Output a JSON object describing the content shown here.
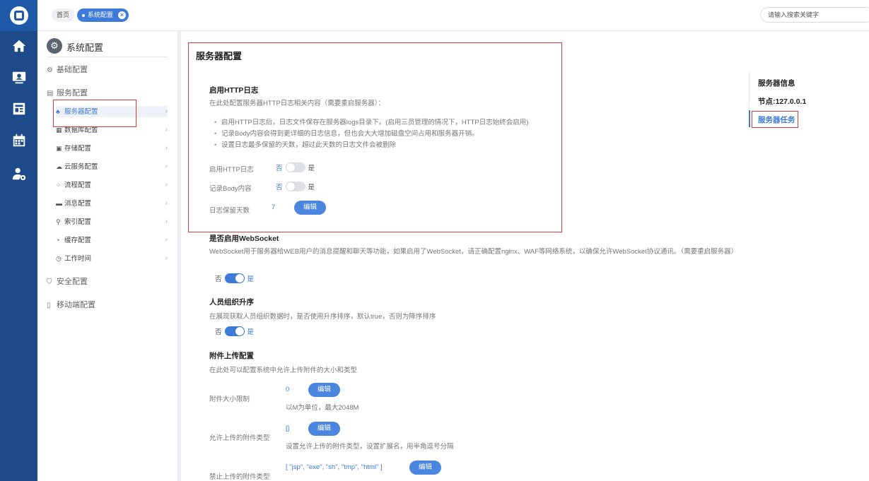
{
  "topbar": {
    "tabs": [
      {
        "label": "首页",
        "active": false
      },
      {
        "label": "系统配置",
        "active": true
      }
    ],
    "search_placeholder": "请输入搜索关键字"
  },
  "rail": {
    "icons": [
      "logo-icon",
      "home-icon",
      "monitor-icon",
      "news-icon",
      "calendar-icon",
      "user-settings-icon"
    ]
  },
  "sidebar": {
    "title": "系统配置",
    "groups": [
      {
        "label": "基础配置"
      },
      {
        "label": "服务配置"
      },
      {
        "label": "安全配置"
      },
      {
        "label": "移动端配置"
      }
    ],
    "items": [
      {
        "label": "服务器配置",
        "active": true
      },
      {
        "label": "数据库配置"
      },
      {
        "label": "存储配置"
      },
      {
        "label": "云服务配置"
      },
      {
        "label": "流程配置"
      },
      {
        "label": "消息配置"
      },
      {
        "label": "索引配置"
      },
      {
        "label": "缓存配置"
      },
      {
        "label": "工作时间"
      }
    ]
  },
  "main": {
    "title": "服务器配置",
    "http_log": {
      "heading": "启用HTTP日志",
      "desc": "在此处配置服务器HTTP日志相关内容（需要重启服务器）：",
      "bullets": [
        "启用HTTP日志后，日志文件保存在服务器logs目录下。(启用三员管理的情况下，HTTP日志始终会启用)",
        "记录Body内容会得到更详细的日志信息，但也会大大增加磁盘空间占用和服务器开销。",
        "设置日志最多保留的天数，超过此天数的日志文件会被删除"
      ],
      "enable_label": "启用HTTP日志",
      "body_label": "记录Body内容",
      "days_label": "日志保留天数",
      "days_value": "7",
      "no": "否",
      "yes": "是",
      "edit": "编辑"
    },
    "websocket": {
      "heading": "是否启用WebSocket",
      "desc": "WebSocket用于服务器给WEB用户的消息提醒和聊天等功能，如果启用了WebSocket，请正确配置nginx、WAF等网络系统，以确保允许WebSocket协议通讯。（需要重启服务器）",
      "no": "否",
      "yes": "是"
    },
    "org_sort": {
      "heading": "人员组织升序",
      "desc": "在展现获取人员组织数据时，是否使用升序排序，默认true，否则为降序排序",
      "no": "否",
      "yes": "是"
    },
    "attachment": {
      "heading": "附件上传配置",
      "desc": "在此处可以配置系统中允许上传附件的大小和类型",
      "size_label": "附件大小限制",
      "size_value": "0",
      "size_hint": "以M为单位，最大2048M",
      "allow_label": "允许上传的附件类型",
      "allow_value": "[]",
      "allow_hint": "设置允许上传的附件类型，设置扩展名，用半角逗号分隔",
      "deny_label": "禁止上传的附件类型",
      "deny_value": "[ \"jsp\", \"exe\", \"sh\", \"tmp\", \"html\" ]",
      "edit": "编辑"
    }
  },
  "right_panel": {
    "title": "服务器信息",
    "node": "节点:127.0.0.1",
    "link": "服务器任务"
  },
  "colors": {
    "rail": "#1c4a8a",
    "accent": "#3d7ad9",
    "highlight_box": "#d93a3a"
  }
}
